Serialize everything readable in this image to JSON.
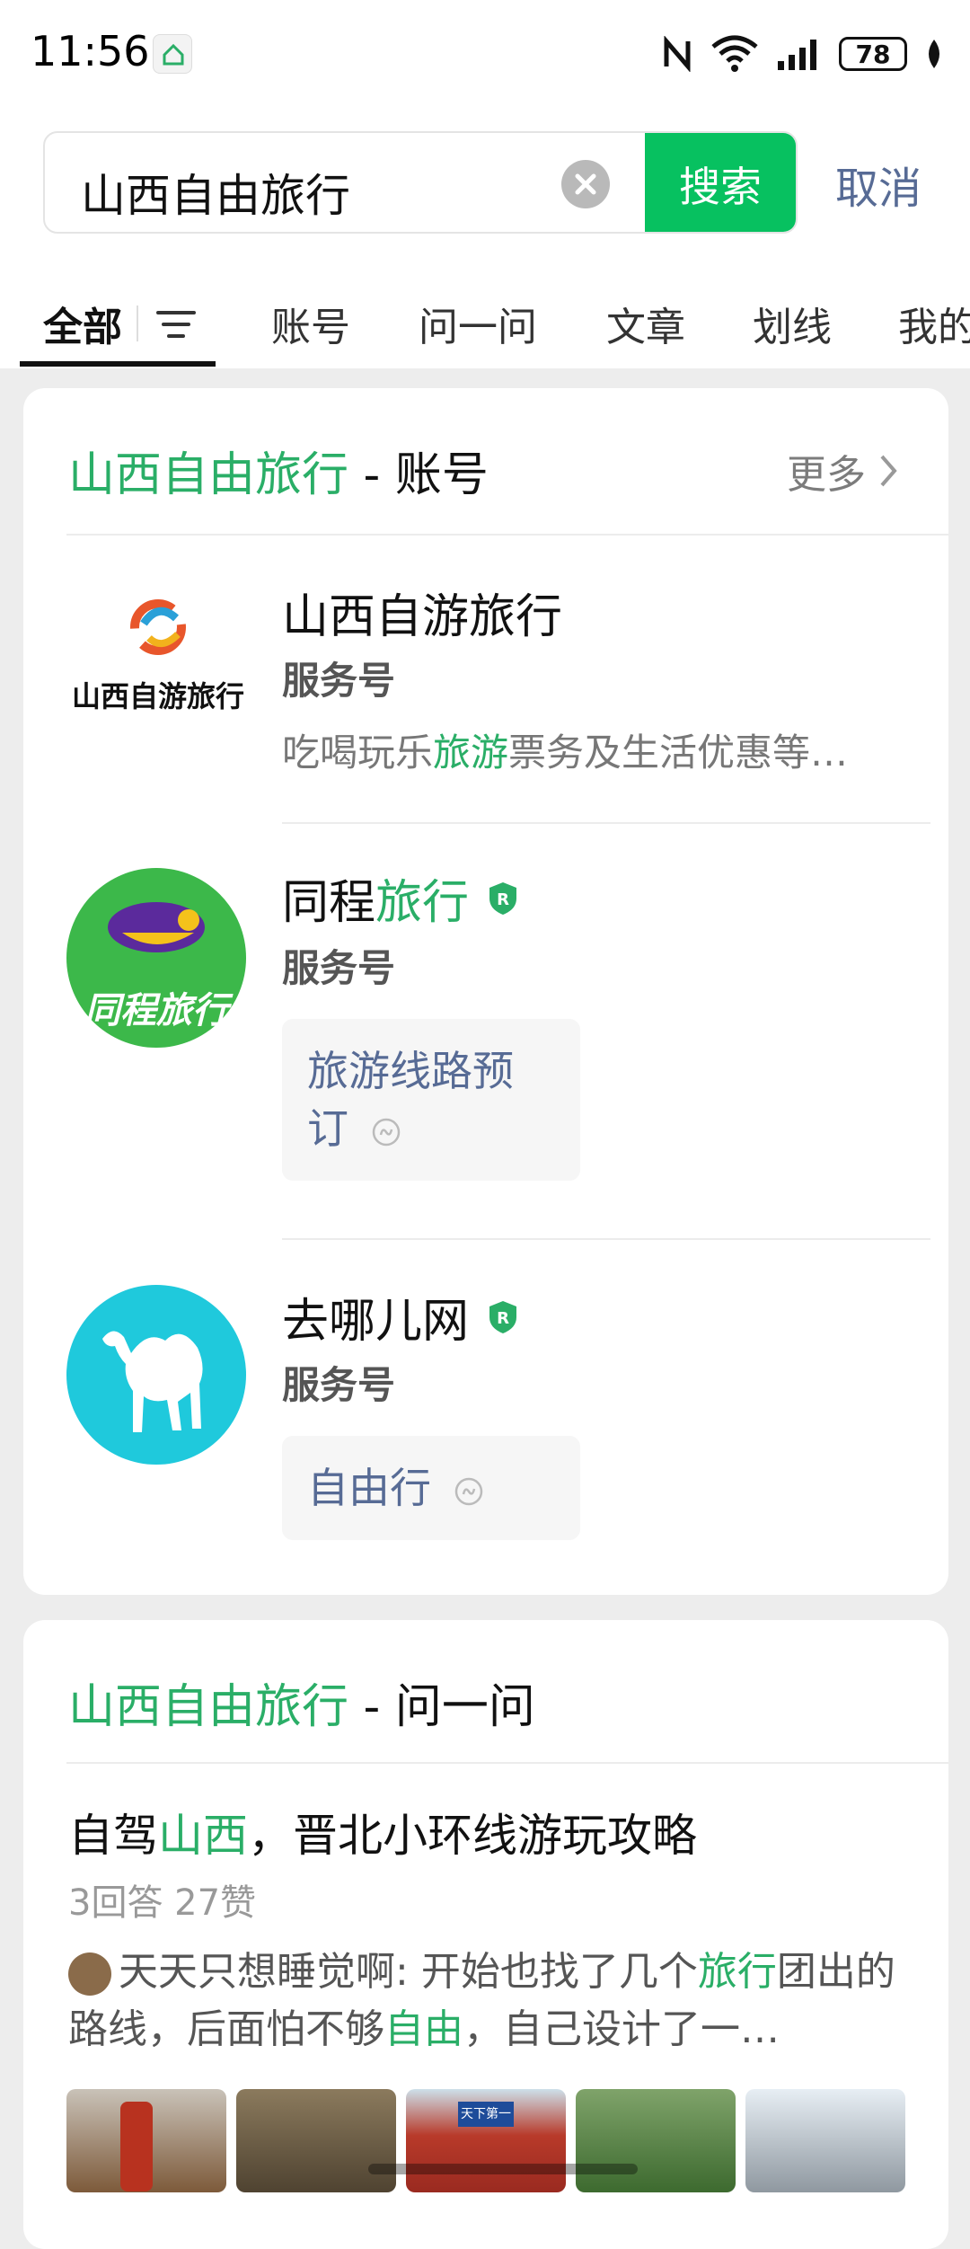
{
  "status_bar": {
    "time": "11:56",
    "battery": "78"
  },
  "search": {
    "query": "山西自由旅行",
    "button_label": "搜索",
    "cancel_label": "取消"
  },
  "tabs": [
    {
      "label": "全部"
    },
    {
      "label": "账号"
    },
    {
      "label": "问一问"
    },
    {
      "label": "文章"
    },
    {
      "label": "划线"
    },
    {
      "label": "我的"
    }
  ],
  "accounts_section": {
    "title_keyword": "山西自由旅行",
    "title_suffix": " - 账号",
    "more_label": "更多",
    "accounts": [
      {
        "name": "山西自游旅行",
        "logo_text": "山西自游旅行",
        "type": "服务号",
        "desc_pre": "吃喝玩乐",
        "desc_hl": "旅游",
        "desc_post": "票务及生活优惠等…"
      },
      {
        "name_pre": "同程",
        "name_hl": "旅行",
        "logo_text": "同程旅行",
        "type": "服务号",
        "chip_line1": "旅游线路预",
        "chip_line2": "订"
      },
      {
        "name": "去哪儿网",
        "type": "服务号",
        "chip": "自由行"
      }
    ]
  },
  "qa_section": {
    "title_keyword": "山西自由旅行",
    "title_suffix": " - 问一问",
    "item": {
      "title_pre": "自驾",
      "title_hl": "山西",
      "title_post": "，晋北小环线游玩攻略",
      "meta": "3回答 27赞",
      "snippet_user": "天天只想睡觉啊:",
      "snippet_1": " 开始也找了几个",
      "snippet_hl1": "旅行",
      "snippet_2": "团出的路线，后面怕不够",
      "snippet_hl2": "自由",
      "snippet_3": "，自己设计了一…"
    },
    "thumb_sign": "天下第一"
  },
  "colors": {
    "accent": "#07c160",
    "highlight": "#2aae67",
    "link": "#576b95"
  }
}
